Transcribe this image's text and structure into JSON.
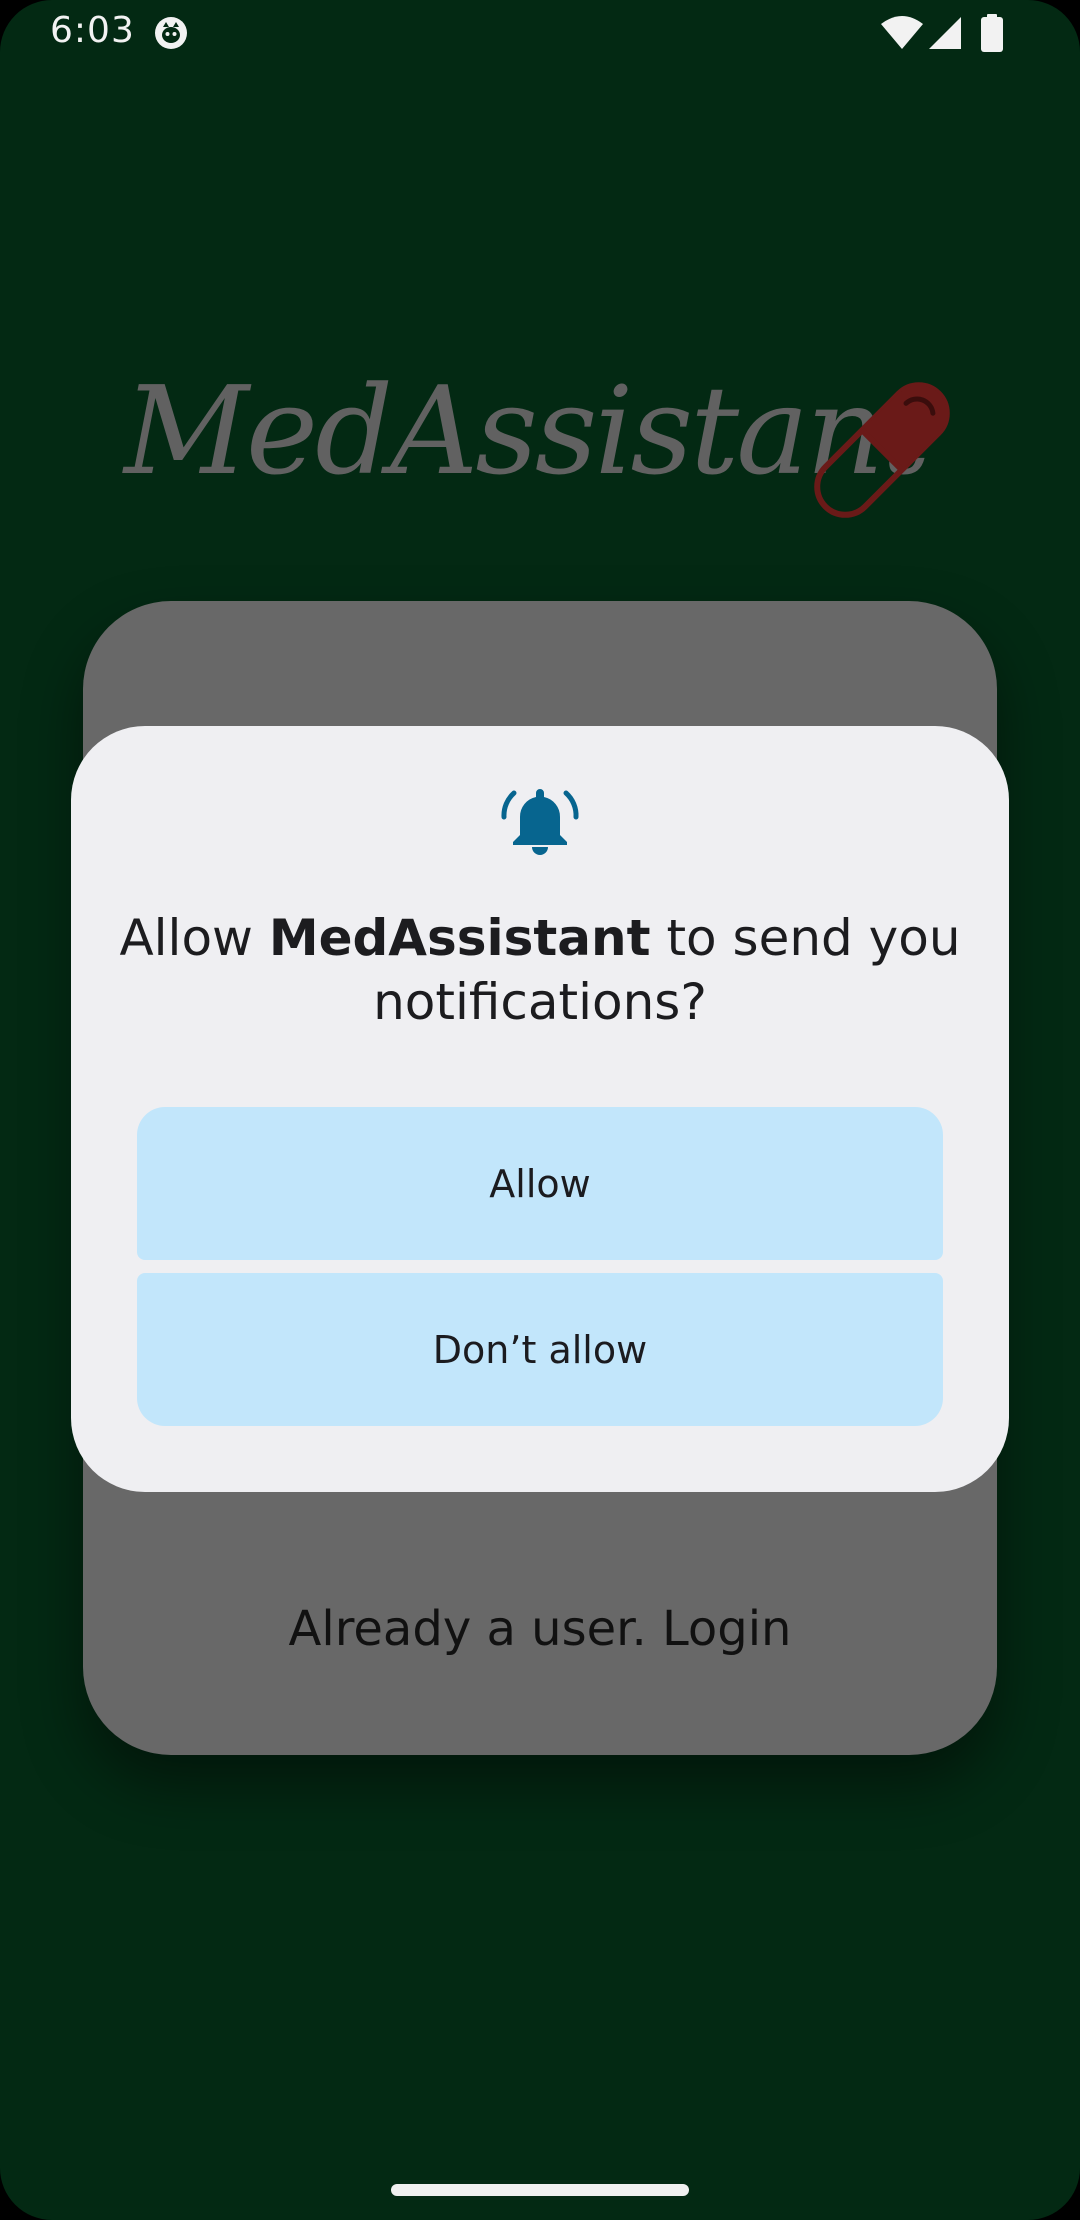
{
  "status_bar": {
    "time": "6:03",
    "icons": [
      "app-notification-icon",
      "wifi-icon",
      "signal-icon",
      "battery-icon"
    ]
  },
  "app": {
    "logo_text": "MedAssistant",
    "logo_icon": "pill-icon",
    "background_login_link": "Already a user. Login"
  },
  "dialog": {
    "icon": "bell-icon",
    "title_prefix": "Allow ",
    "title_app": "MedAssistant",
    "title_suffix": " to send you notifications?",
    "allow_label": "Allow",
    "dont_allow_label": "Don’t allow"
  },
  "colors": {
    "background": "#032913",
    "card": "#686868",
    "dialog": "#efeff2",
    "button": "#c2e6fb",
    "bell": "#07658f",
    "pill": "#6a1a18"
  }
}
